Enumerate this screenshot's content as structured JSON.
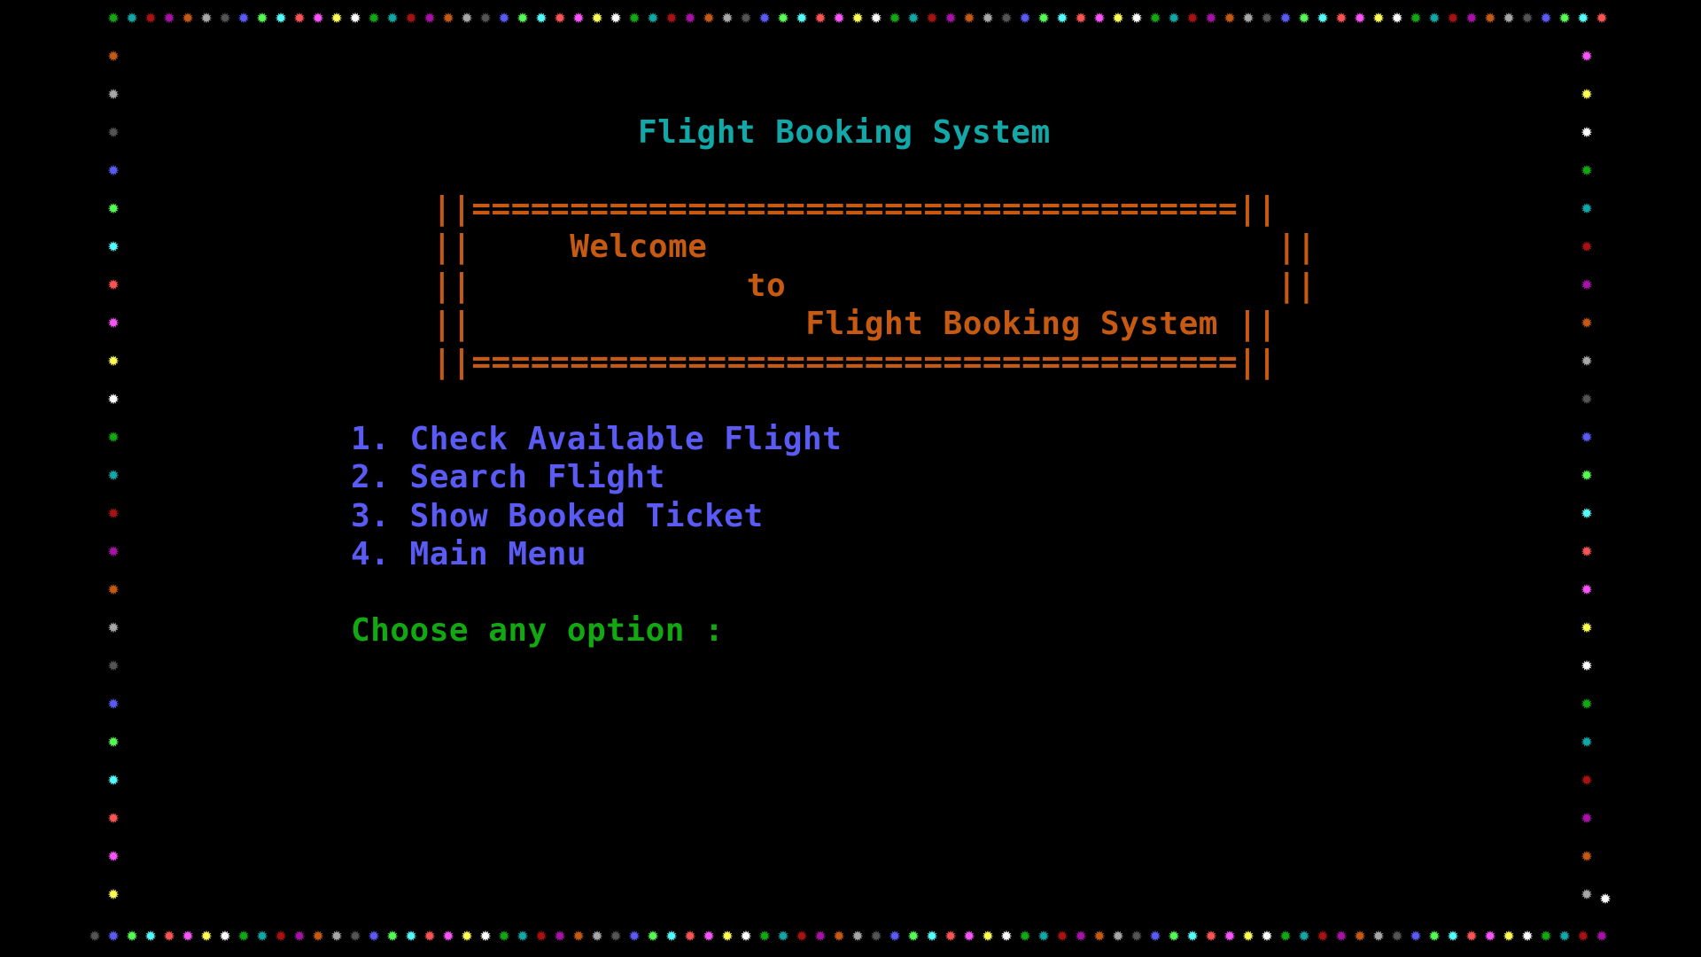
{
  "app": {
    "title": "Flight Booking System"
  },
  "banner": {
    "top_border": "||=======================================||",
    "line_welcome": "||     Welcome                             ||",
    "line_to": "||              to                         ||",
    "line_system": "||                 Flight Booking System ||",
    "bottom_border": "||=======================================||"
  },
  "menu": {
    "items": [
      {
        "label": "1. Check Available Flight"
      },
      {
        "label": "2. Search Flight"
      },
      {
        "label": "3. Show Booked Ticket"
      },
      {
        "label": "4. Main Menu"
      }
    ]
  },
  "prompt": {
    "label": "Choose any option :",
    "value": ""
  },
  "border": {
    "glyph": "✹",
    "palette": [
      "#12a812",
      "#12a8a8",
      "#a81212",
      "#a812a8",
      "#c65a12",
      "#a8a8a8",
      "#545454",
      "#5a5af5",
      "#54fc54",
      "#54fcfc",
      "#fc5454",
      "#fc54fc",
      "#fcfc54",
      "#fcfcfc"
    ]
  }
}
